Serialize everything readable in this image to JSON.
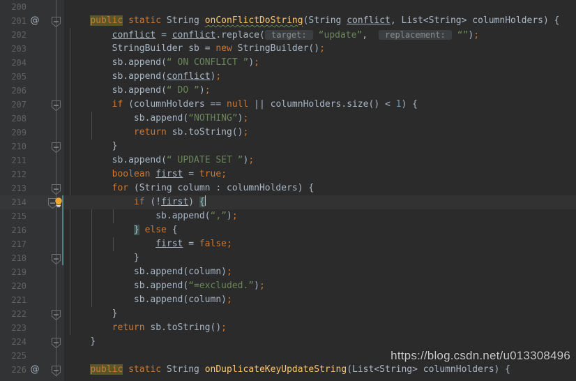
{
  "editor": {
    "theme": "darcula",
    "background": "#2b2b2b",
    "gutter_background": "#313335",
    "current_line_background": "#323232",
    "first_visible_line": 200,
    "caret_line": 214,
    "line_height": 20,
    "colors": {
      "keyword": "#cc7832",
      "string": "#6a8759",
      "method": "#ffc66d",
      "default_text": "#a9b7c6",
      "line_number": "#606366",
      "number": "#6897bb",
      "inlay_hint_text": "#8c8c8c",
      "inlay_hint_bg": "#3b3f41",
      "identifier_highlight_bg": "#5a5627",
      "brace_match_bg": "#3b514d",
      "vcs_change_marker": "#4a8585",
      "indent_guide": "#4b4e50",
      "fold_rail": "#5e6060",
      "bulb": "#f0a732"
    }
  },
  "watermark": {
    "text": "https://blog.csdn.net/u013308496"
  },
  "gutter_icons": {
    "override_marker": "@",
    "fold_marker": "fold-minus-icon",
    "intention_bulb": "lightbulb-icon"
  },
  "lines": [
    {
      "no": 200,
      "indent": 0,
      "fold": false,
      "override": false,
      "tokens": []
    },
    {
      "no": 201,
      "indent": 0,
      "fold": true,
      "override": true,
      "tokens": [
        {
          "t": "    ",
          "c": "plain"
        },
        {
          "t": "public",
          "c": "kw hl-ident"
        },
        {
          "t": " ",
          "c": "plain"
        },
        {
          "t": "static",
          "c": "kw"
        },
        {
          "t": " ",
          "c": "plain"
        },
        {
          "t": "String",
          "c": "type"
        },
        {
          "t": " ",
          "c": "plain"
        },
        {
          "t": "onConFlictDoString",
          "c": "fn squiggle"
        },
        {
          "t": "(",
          "c": "punct"
        },
        {
          "t": "String",
          "c": "type"
        },
        {
          "t": " ",
          "c": "plain"
        },
        {
          "t": "conflict",
          "c": "plain uline"
        },
        {
          "t": ", ",
          "c": "punct"
        },
        {
          "t": "List<String> columnHolders",
          "c": "plain"
        },
        {
          "t": ") {",
          "c": "punct"
        }
      ]
    },
    {
      "no": 202,
      "indent": 1,
      "fold": false,
      "override": false,
      "tokens": [
        {
          "t": "        ",
          "c": "plain"
        },
        {
          "t": "conflict",
          "c": "plain uline"
        },
        {
          "t": " = ",
          "c": "op"
        },
        {
          "t": "conflict",
          "c": "plain uline"
        },
        {
          "t": ".replace(",
          "c": "punct"
        },
        {
          "t": " target: ",
          "c": "hint"
        },
        {
          "t": " ",
          "c": "plain"
        },
        {
          "t": "“update”",
          "c": "str"
        },
        {
          "t": ",  ",
          "c": "punct"
        },
        {
          "t": " replacement: ",
          "c": "hint"
        },
        {
          "t": " ",
          "c": "plain"
        },
        {
          "t": "“”",
          "c": "str"
        },
        {
          "t": ")",
          "c": "punct"
        },
        {
          "t": ";",
          "c": "semi"
        }
      ]
    },
    {
      "no": 203,
      "indent": 1,
      "fold": false,
      "override": false,
      "tokens": [
        {
          "t": "        ",
          "c": "plain"
        },
        {
          "t": "StringBuilder sb ",
          "c": "plain"
        },
        {
          "t": "= ",
          "c": "op"
        },
        {
          "t": "new",
          "c": "kw"
        },
        {
          "t": " StringBuilder()",
          "c": "plain"
        },
        {
          "t": ";",
          "c": "semi"
        }
      ]
    },
    {
      "no": 204,
      "indent": 1,
      "fold": false,
      "override": false,
      "tokens": [
        {
          "t": "        ",
          "c": "plain"
        },
        {
          "t": "sb.append(",
          "c": "plain"
        },
        {
          "t": "“ ON CONFLICT ”",
          "c": "str"
        },
        {
          "t": ")",
          "c": "punct"
        },
        {
          "t": ";",
          "c": "semi"
        }
      ]
    },
    {
      "no": 205,
      "indent": 1,
      "fold": false,
      "override": false,
      "tokens": [
        {
          "t": "        ",
          "c": "plain"
        },
        {
          "t": "sb.append(",
          "c": "plain"
        },
        {
          "t": "conflict",
          "c": "plain uline"
        },
        {
          "t": ")",
          "c": "punct"
        },
        {
          "t": ";",
          "c": "semi"
        }
      ]
    },
    {
      "no": 206,
      "indent": 1,
      "fold": false,
      "override": false,
      "tokens": [
        {
          "t": "        ",
          "c": "plain"
        },
        {
          "t": "sb.append(",
          "c": "plain"
        },
        {
          "t": "“ DO ”",
          "c": "str"
        },
        {
          "t": ")",
          "c": "punct"
        },
        {
          "t": ";",
          "c": "semi"
        }
      ]
    },
    {
      "no": 207,
      "indent": 1,
      "fold": true,
      "override": false,
      "tokens": [
        {
          "t": "        ",
          "c": "plain"
        },
        {
          "t": "if",
          "c": "kw"
        },
        {
          "t": " (columnHolders ",
          "c": "plain"
        },
        {
          "t": "== ",
          "c": "op"
        },
        {
          "t": "null",
          "c": "kw"
        },
        {
          "t": " || ",
          "c": "op"
        },
        {
          "t": "columnHolders.size() ",
          "c": "plain"
        },
        {
          "t": "< ",
          "c": "op"
        },
        {
          "t": "1",
          "c": "num"
        },
        {
          "t": ") {",
          "c": "punct"
        }
      ]
    },
    {
      "no": 208,
      "indent": 2,
      "fold": false,
      "override": false,
      "tokens": [
        {
          "t": "            ",
          "c": "plain"
        },
        {
          "t": "sb.append(",
          "c": "plain"
        },
        {
          "t": "“NOTHING”",
          "c": "str"
        },
        {
          "t": ")",
          "c": "punct"
        },
        {
          "t": ";",
          "c": "semi"
        }
      ]
    },
    {
      "no": 209,
      "indent": 2,
      "fold": false,
      "override": false,
      "tokens": [
        {
          "t": "            ",
          "c": "plain"
        },
        {
          "t": "return",
          "c": "kw"
        },
        {
          "t": " sb.toString()",
          "c": "plain"
        },
        {
          "t": ";",
          "c": "semi"
        }
      ]
    },
    {
      "no": 210,
      "indent": 1,
      "fold": true,
      "override": false,
      "tokens": [
        {
          "t": "        ",
          "c": "plain"
        },
        {
          "t": "}",
          "c": "punct"
        }
      ]
    },
    {
      "no": 211,
      "indent": 1,
      "fold": false,
      "override": false,
      "tokens": [
        {
          "t": "        ",
          "c": "plain"
        },
        {
          "t": "sb.append(",
          "c": "plain"
        },
        {
          "t": "“ UPDATE SET ”",
          "c": "str"
        },
        {
          "t": ")",
          "c": "punct"
        },
        {
          "t": ";",
          "c": "semi"
        }
      ]
    },
    {
      "no": 212,
      "indent": 1,
      "fold": false,
      "override": false,
      "tokens": [
        {
          "t": "        ",
          "c": "plain"
        },
        {
          "t": "boolean",
          "c": "kw"
        },
        {
          "t": " ",
          "c": "plain"
        },
        {
          "t": "first",
          "c": "plain uline"
        },
        {
          "t": " = ",
          "c": "op"
        },
        {
          "t": "true",
          "c": "kw"
        },
        {
          "t": ";",
          "c": "semi"
        }
      ]
    },
    {
      "no": 213,
      "indent": 1,
      "fold": true,
      "override": false,
      "tokens": [
        {
          "t": "        ",
          "c": "plain"
        },
        {
          "t": "for",
          "c": "kw"
        },
        {
          "t": " (String column : columnHolders) {",
          "c": "plain"
        }
      ]
    },
    {
      "no": 214,
      "indent": 2,
      "fold": true,
      "override": false,
      "current": true,
      "change": true,
      "bulb": true,
      "tokens": [
        {
          "t": "            ",
          "c": "plain"
        },
        {
          "t": "if",
          "c": "kw"
        },
        {
          "t": " (!",
          "c": "plain"
        },
        {
          "t": "first",
          "c": "plain uline"
        },
        {
          "t": ") ",
          "c": "punct"
        },
        {
          "t": "{",
          "c": "punct brace-match"
        },
        {
          "t": "CARET",
          "c": "caret"
        }
      ]
    },
    {
      "no": 215,
      "indent": 3,
      "fold": false,
      "override": false,
      "change": true,
      "tokens": [
        {
          "t": "                ",
          "c": "plain"
        },
        {
          "t": "sb.append(",
          "c": "plain"
        },
        {
          "t": "“,”",
          "c": "str"
        },
        {
          "t": ")",
          "c": "punct"
        },
        {
          "t": ";",
          "c": "semi"
        }
      ]
    },
    {
      "no": 216,
      "indent": 2,
      "fold": false,
      "override": false,
      "change": true,
      "tokens": [
        {
          "t": "            ",
          "c": "plain"
        },
        {
          "t": "}",
          "c": "punct brace-match"
        },
        {
          "t": " ",
          "c": "plain"
        },
        {
          "t": "else",
          "c": "kw"
        },
        {
          "t": " {",
          "c": "punct"
        }
      ]
    },
    {
      "no": 217,
      "indent": 3,
      "fold": false,
      "override": false,
      "change": true,
      "tokens": [
        {
          "t": "                ",
          "c": "plain"
        },
        {
          "t": "first",
          "c": "plain uline"
        },
        {
          "t": " = ",
          "c": "op"
        },
        {
          "t": "false",
          "c": "kw"
        },
        {
          "t": ";",
          "c": "semi"
        }
      ]
    },
    {
      "no": 218,
      "indent": 2,
      "fold": true,
      "override": false,
      "change": true,
      "tokens": [
        {
          "t": "            ",
          "c": "plain"
        },
        {
          "t": "}",
          "c": "punct"
        }
      ]
    },
    {
      "no": 219,
      "indent": 2,
      "fold": false,
      "override": false,
      "tokens": [
        {
          "t": "            ",
          "c": "plain"
        },
        {
          "t": "sb.append(column)",
          "c": "plain"
        },
        {
          "t": ";",
          "c": "semi"
        }
      ]
    },
    {
      "no": 220,
      "indent": 2,
      "fold": false,
      "override": false,
      "tokens": [
        {
          "t": "            ",
          "c": "plain"
        },
        {
          "t": "sb.append(",
          "c": "plain"
        },
        {
          "t": "“=excluded.”",
          "c": "str"
        },
        {
          "t": ")",
          "c": "punct"
        },
        {
          "t": ";",
          "c": "semi"
        }
      ]
    },
    {
      "no": 221,
      "indent": 2,
      "fold": false,
      "override": false,
      "tokens": [
        {
          "t": "            ",
          "c": "plain"
        },
        {
          "t": "sb.append(column)",
          "c": "plain"
        },
        {
          "t": ";",
          "c": "semi"
        }
      ]
    },
    {
      "no": 222,
      "indent": 1,
      "fold": true,
      "override": false,
      "tokens": [
        {
          "t": "        ",
          "c": "plain"
        },
        {
          "t": "}",
          "c": "punct"
        }
      ]
    },
    {
      "no": 223,
      "indent": 1,
      "fold": false,
      "override": false,
      "tokens": [
        {
          "t": "        ",
          "c": "plain"
        },
        {
          "t": "return",
          "c": "kw"
        },
        {
          "t": " sb.toString()",
          "c": "plain"
        },
        {
          "t": ";",
          "c": "semi"
        }
      ]
    },
    {
      "no": 224,
      "indent": 0,
      "fold": true,
      "override": false,
      "tokens": [
        {
          "t": "    ",
          "c": "plain"
        },
        {
          "t": "}",
          "c": "punct"
        }
      ]
    },
    {
      "no": 225,
      "indent": 0,
      "fold": false,
      "override": false,
      "tokens": []
    },
    {
      "no": 226,
      "indent": 0,
      "fold": true,
      "override": true,
      "tokens": [
        {
          "t": "    ",
          "c": "plain"
        },
        {
          "t": "public",
          "c": "kw hl-ident"
        },
        {
          "t": " ",
          "c": "plain"
        },
        {
          "t": "static",
          "c": "kw"
        },
        {
          "t": " ",
          "c": "plain"
        },
        {
          "t": "String",
          "c": "type"
        },
        {
          "t": " ",
          "c": "plain"
        },
        {
          "t": "onDuplicateKeyUpdateString",
          "c": "fn"
        },
        {
          "t": "(",
          "c": "punct"
        },
        {
          "t": "List<String> columnHolders",
          "c": "plain"
        },
        {
          "t": ") {",
          "c": "punct"
        }
      ]
    }
  ]
}
